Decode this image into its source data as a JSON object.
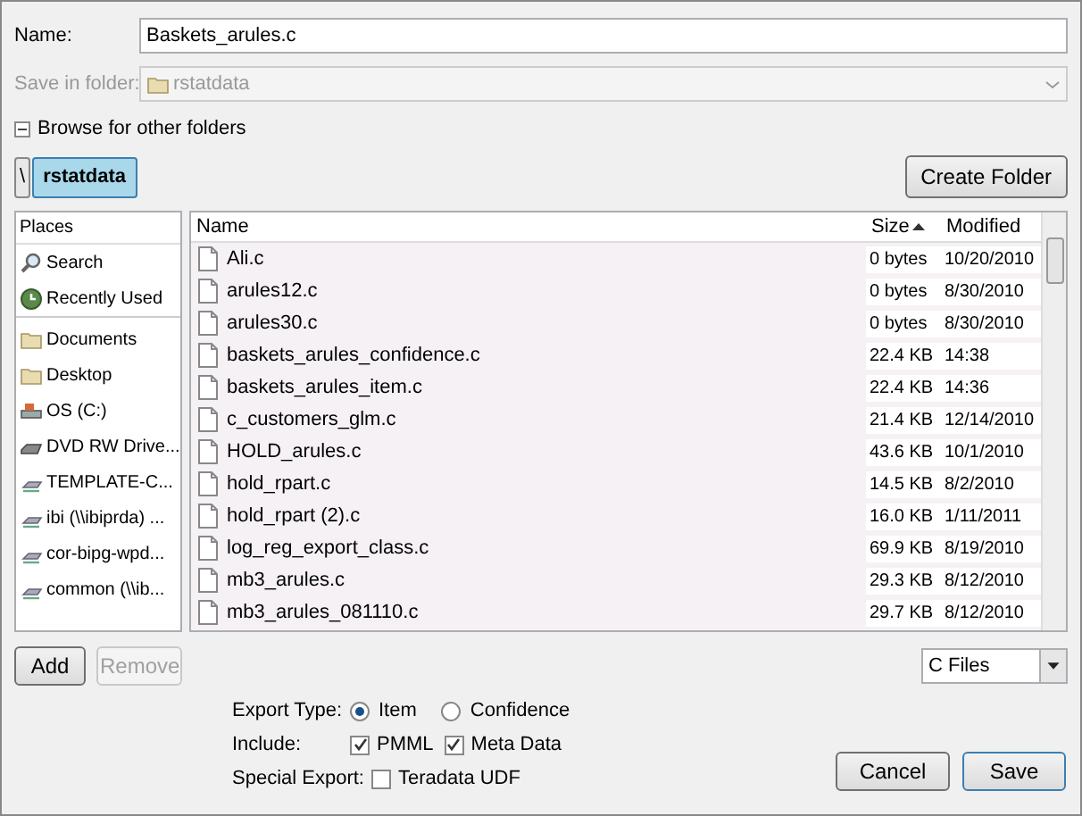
{
  "name_field": {
    "label": "Name:",
    "value": "Baskets_arules.c"
  },
  "save_in_folder": {
    "label": "Save in folder:",
    "value": "rstatdata",
    "disabled": true
  },
  "browse": {
    "label": "Browse for other folders",
    "expanded": true
  },
  "path_buttons": [
    {
      "label": "\\",
      "selected": false
    },
    {
      "label": "rstatdata",
      "selected": true
    }
  ],
  "create_folder_button": "Create Folder",
  "places": {
    "header": "Places",
    "groups": [
      {
        "items": [
          {
            "label": "Search",
            "kind": "search"
          },
          {
            "label": "Recently Used",
            "kind": "recent"
          }
        ]
      },
      {
        "items": [
          {
            "label": "Documents",
            "kind": "folder"
          },
          {
            "label": "Desktop",
            "kind": "folder"
          },
          {
            "label": "OS (C:)",
            "kind": "drive"
          },
          {
            "label": "DVD RW Drive...",
            "kind": "dvd"
          },
          {
            "label": "TEMPLATE-C...",
            "kind": "network"
          },
          {
            "label": "ibi (\\\\ibiprda) ...",
            "kind": "network"
          },
          {
            "label": "cor-bipg-wpd...",
            "kind": "network"
          },
          {
            "label": "common (\\\\ib...",
            "kind": "network"
          }
        ]
      }
    ]
  },
  "files": {
    "columns": [
      {
        "label": "Name",
        "sorted": false
      },
      {
        "label": "Size",
        "sorted": true
      },
      {
        "label": "Modified",
        "sorted": false
      }
    ],
    "rows": [
      [
        "Ali.c",
        "0 bytes",
        "10/20/2010"
      ],
      [
        "arules12.c",
        "0 bytes",
        "8/30/2010"
      ],
      [
        "arules30.c",
        "0 bytes",
        "8/30/2010"
      ],
      [
        "baskets_arules_confidence.c",
        "22.4 KB",
        "14:38"
      ],
      [
        "baskets_arules_item.c",
        "22.4 KB",
        "14:36"
      ],
      [
        "c_customers_glm.c",
        "21.4 KB",
        "12/14/2010"
      ],
      [
        "HOLD_arules.c",
        "43.6 KB",
        "10/1/2010"
      ],
      [
        "hold_rpart.c",
        "14.5 KB",
        "8/2/2010"
      ],
      [
        "hold_rpart (2).c",
        "16.0 KB",
        "1/11/2011"
      ],
      [
        "log_reg_export_class.c",
        "69.9 KB",
        "8/19/2010"
      ],
      [
        "mb3_arules.c",
        "29.3 KB",
        "8/12/2010"
      ],
      [
        "mb3_arules_081110.c",
        "29.7 KB",
        "8/12/2010"
      ]
    ]
  },
  "add_button": {
    "label": "Add",
    "disabled": false
  },
  "remove_button": {
    "label": "Remove",
    "disabled": true
  },
  "filter": "C Files",
  "export_type": {
    "label": "Export Type:",
    "options": [
      {
        "label": "Item",
        "selected": true
      },
      {
        "label": "Confidence",
        "selected": false
      }
    ]
  },
  "include": {
    "label": "Include:",
    "options": [
      {
        "label": "PMML",
        "checked": true
      },
      {
        "label": "Meta Data",
        "checked": true
      }
    ]
  },
  "special_export": {
    "label": "Special Export:",
    "options": [
      {
        "label": "Teradata UDF",
        "checked": false
      }
    ]
  },
  "cancel_button": "Cancel",
  "save_button": "Save"
}
